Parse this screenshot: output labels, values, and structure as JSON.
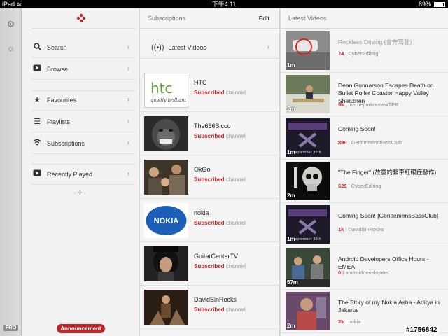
{
  "statusbar": {
    "device": "iPad",
    "time": "下午4:11",
    "battery": "89%",
    "battery_fraction": 0.89
  },
  "rail": {
    "pro_label": "PRO"
  },
  "menu": {
    "items": [
      {
        "label": "Search"
      },
      {
        "label": "Browse"
      },
      {
        "label": "Favourites"
      },
      {
        "label": "Playlists"
      },
      {
        "label": "Subscriptions"
      },
      {
        "label": "Recently Played"
      }
    ],
    "announcement": "Announcement"
  },
  "subscriptions": {
    "header": "Subscriptions",
    "edit_label": "Edit",
    "latest_label": "Latest Videos",
    "items": [
      {
        "name": "HTC",
        "subscribed": "Subscribed",
        "type": "channel",
        "thumb_text": "htc",
        "thumb_sub": "quietly brilliant"
      },
      {
        "name": "The666Sicco",
        "subscribed": "Subscribed",
        "type": "channel"
      },
      {
        "name": "OkGo",
        "subscribed": "Subscribed",
        "type": "channel"
      },
      {
        "name": "nokia",
        "subscribed": "Subscribed",
        "type": "channel",
        "thumb_text": "NOKIA"
      },
      {
        "name": "GuitarCenterTV",
        "subscribed": "Subscribed",
        "type": "channel"
      },
      {
        "name": "DavidSinRocks",
        "subscribed": "Subscribed",
        "type": "channel"
      }
    ]
  },
  "latest": {
    "header": "Latest Videos",
    "items": [
      {
        "title": "Reckless Driving (會奔驾驶)",
        "count": "74",
        "channel": "CyberEditing",
        "duration": "1m"
      },
      {
        "title": "Dean Gunnarson Escapes Death on Bullet Roller Coaster Happy Valley Shenzhen",
        "count": "5k",
        "channel": "themeparkreviewTPR",
        "duration": "2m"
      },
      {
        "title": "Coming Soon!",
        "count": "890",
        "channel": "GentlemensBassClub",
        "duration": "1m",
        "thumb_caption": "eptember 30th"
      },
      {
        "title": "\"The Finger\" (故意的繫車紅眼症發作)",
        "count": "625",
        "channel": "CyberEditing",
        "duration": "2m"
      },
      {
        "title": "Coming Soon! [GentlemensBassClub]",
        "count": "1k",
        "channel": "DavidSinRocks",
        "duration": "1m",
        "thumb_caption": "eptember 30th"
      },
      {
        "title": "Android Developers Office Hours - EMEA",
        "count": "0",
        "channel": "androiddevelopers",
        "duration": "57m"
      },
      {
        "title": "The Story of my Nokia Asha - Aditya in Jakarta",
        "count": "2k",
        "channel": "nokia",
        "duration": "2m"
      }
    ]
  },
  "watermark": "#1756842",
  "colors": {
    "accent": "#c0272d",
    "announcement": "#b8282c"
  }
}
